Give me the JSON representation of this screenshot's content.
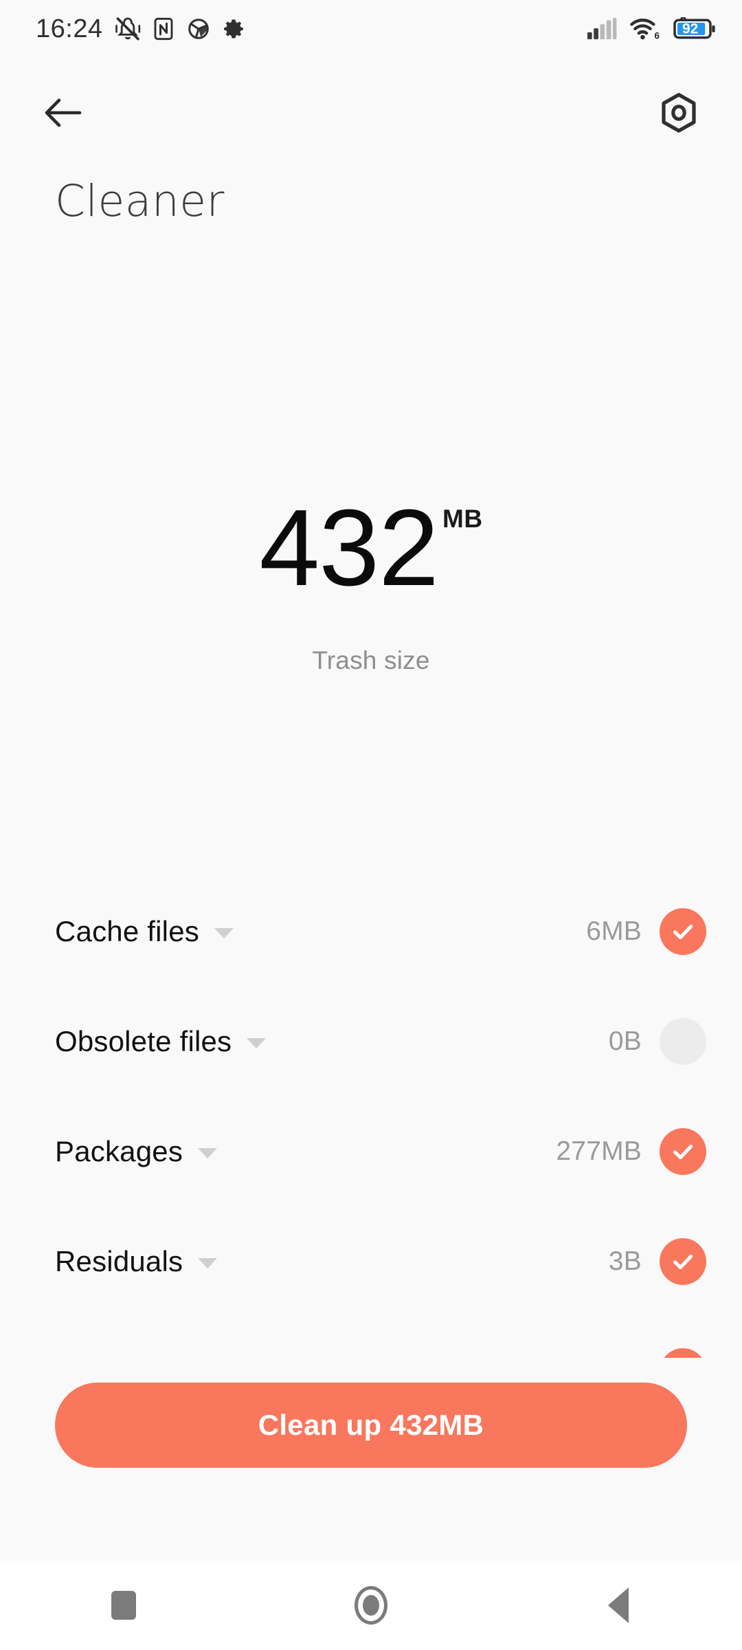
{
  "status_bar": {
    "time": "16:24",
    "icons_left": [
      "vibrate-off-icon",
      "nfc-icon",
      "sphere-icon",
      "gear-icon"
    ],
    "icons_right": [
      "signal-icon",
      "wifi-icon",
      "battery-icon"
    ],
    "wifi_generation": "6",
    "battery_percent": "92",
    "battery_color": "#2196f3",
    "icon_color": "#2f2f2f"
  },
  "app_bar": {
    "back_icon": "arrow-left-icon",
    "settings_icon": "hex-nut-icon"
  },
  "header": {
    "title": "Cleaner"
  },
  "hero": {
    "value": "432",
    "unit": "MB",
    "caption": "Trash size"
  },
  "categories": {
    "rows": [
      {
        "label": "Cache files",
        "size": "6MB",
        "checked": true
      },
      {
        "label": "Obsolete files",
        "size": "0B",
        "checked": false
      },
      {
        "label": "Packages",
        "size": "277MB",
        "checked": true
      },
      {
        "label": "Residuals",
        "size": "3B",
        "checked": true
      },
      {
        "label": "",
        "size": "",
        "checked": true
      }
    ]
  },
  "cta": {
    "label": "Clean up 432MB"
  },
  "nav_bar": {
    "recents_icon": "square-icon",
    "home_icon": "circle-icon",
    "back_icon": "triangle-left-icon"
  },
  "colors": {
    "accent": "#f8775d",
    "surface": "#f9f9f9",
    "nav_surface": "#ffffff",
    "muted_text": "#9a9a9a",
    "checkbox_off": "#ececec"
  }
}
